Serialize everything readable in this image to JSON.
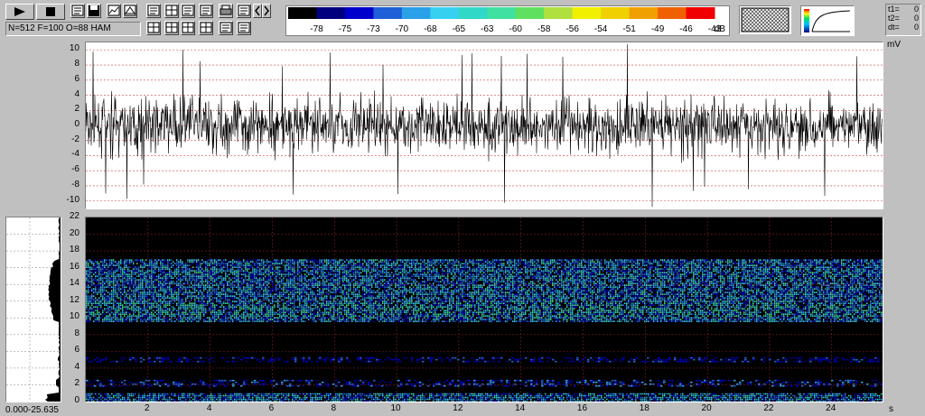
{
  "toolbar": {
    "play_icon": "play-icon",
    "stop_icon": "stop-icon",
    "icons": [
      "window-icon",
      "save-icon",
      "chart-icon",
      "triangle-icon",
      "list-icon",
      "grid-icon",
      "clipboard-icon",
      "settings-icon",
      "print-icon",
      "export-icon",
      "chevron-left-icon",
      "chevron-right-icon",
      "grid2-icon",
      "grid3-icon",
      "grid4-icon",
      "grid5-icon",
      "frame-icon",
      "edit-icon"
    ]
  },
  "status": {
    "params": "N=512 F=100 O=88 HAM"
  },
  "colorbar": {
    "ticks": [
      "-78",
      "-75",
      "-73",
      "-70",
      "-68",
      "-65",
      "-63",
      "-60",
      "-58",
      "-56",
      "-54",
      "-51",
      "-49",
      "-46",
      "-43"
    ],
    "unit": "dB",
    "colors": [
      "#000000",
      "#00007f",
      "#0000cc",
      "#1f5fd8",
      "#2aa0e8",
      "#37d0f0",
      "#30d8c8",
      "#40e0a0",
      "#60e060",
      "#b0e040",
      "#f0f000",
      "#f0d000",
      "#f0a000",
      "#f06000",
      "#f00000"
    ]
  },
  "readout": {
    "t1_label": "t1=",
    "t1_value": "0",
    "t2_label": "t2=",
    "t2_value": "0",
    "dt_label": "dt=",
    "dt_value": "0"
  },
  "histogram": {
    "range_label": "0.000-25.635"
  },
  "chart_data": [
    {
      "type": "line",
      "ylabel": "mV",
      "ylim": [
        -11,
        11
      ],
      "yticks": [
        "10",
        "8",
        "6",
        "4",
        "2",
        "0",
        "-2",
        "-4",
        "-6",
        "-8",
        "-10"
      ],
      "xlim": [
        0,
        25.635
      ],
      "grid": true,
      "amplitude_rms": 2.5,
      "peak_abs": 11
    },
    {
      "type": "heatmap",
      "ylim": [
        0,
        22
      ],
      "yticks": [
        "22",
        "20",
        "18",
        "16",
        "14",
        "12",
        "10",
        "8",
        "6",
        "4",
        "2",
        "0"
      ],
      "xlim": [
        0,
        25.635
      ],
      "xticks": [
        "2",
        "4",
        "6",
        "8",
        "10",
        "12",
        "14",
        "16",
        "18",
        "20",
        "22",
        "24"
      ],
      "xlabel": "s",
      "bands": [
        {
          "low": 9.5,
          "high": 17,
          "intensity": "high"
        },
        {
          "low": 4.8,
          "high": 5.3,
          "intensity": "low"
        },
        {
          "low": 1.8,
          "high": 2.6,
          "intensity": "medium"
        },
        {
          "low": 0,
          "high": 1.0,
          "intensity": "high"
        }
      ]
    }
  ]
}
